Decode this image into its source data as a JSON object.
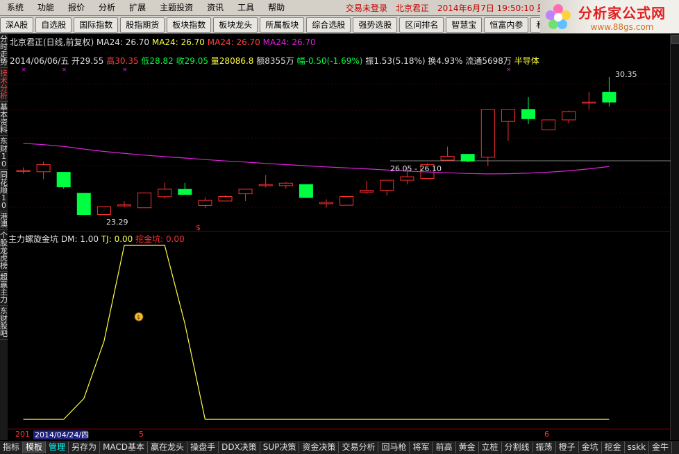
{
  "menu": {
    "items": [
      "系统",
      "功能",
      "报价",
      "分析",
      "扩展",
      "主题投资",
      "资讯",
      "工具",
      "帮助"
    ],
    "status": "交易未登录",
    "stock": "北京君正",
    "datetime": "2014年6月7日 19:50:10 星"
  },
  "toolbar": {
    "buttons": [
      "深A股",
      "自选股",
      "国际指数",
      "股指期货",
      "板块指数",
      "板块龙头",
      "所属板块",
      "综合选股",
      "强势选股",
      "区间排名",
      "智慧宝",
      "恒富内参",
      "私募密"
    ]
  },
  "logo": {
    "title": "分析家公式网",
    "url": "www.88gs.com"
  },
  "left_tabs": [
    "分时走势",
    "技术分析",
    "基本资料",
    "东财10",
    "同花顺10",
    "港澳",
    "个股龙虎榜",
    "超赢主力",
    "东财股吧"
  ],
  "price_panel": {
    "title": "北京君正(日线,前复权)",
    "ma_label": "MA24: 26.70",
    "ma_label2": "MA24: 26.70",
    "ma_label3": "MA24: 26.70",
    "ma_label4": "MA24: 26.70",
    "date": "2014/06/06/五",
    "open": "开29.55",
    "high": "高30.35",
    "low": "低28.82",
    "close": "收29.05",
    "vol": "量28086.8",
    "amount": "额8355万",
    "change": "幅-0.50(-1.69%)",
    "amp": "振1.53(5.18%)",
    "turnover": "换4.93%",
    "float": "流通5698万",
    "sector": "半导体",
    "hi_label": "30.35",
    "lo_label": "23.29",
    "mid_label": "26.05 - 26.10"
  },
  "indicator_panel": {
    "name": "主力螺旋金坑",
    "dm": "DM: 1.00",
    "tj": "TJ: 0.00",
    "wk": "挖金坑: 0.00"
  },
  "xaxis": {
    "left": "201",
    "date": "2014/04/24/四",
    "m5": "5",
    "m6": "6"
  },
  "bottom_tabs": [
    "指标",
    "模板",
    "管理",
    "另存为",
    "MACD基本",
    "赢在龙头",
    "操盘手",
    "DDX决策",
    "SUP决策",
    "资金决策",
    "交易分析",
    "回马枪",
    "将军",
    "前高",
    "黄金",
    "立桩",
    "分割线",
    "振荡",
    "橙子",
    "金坑",
    "挖金",
    "sskk",
    "金牛"
  ],
  "colors": {
    "up": "#ff3030",
    "down": "#00ff40",
    "ma": "#e020e0",
    "indicator": "#ffff40"
  },
  "chart_data": {
    "type": "candlestick",
    "candles": [
      {
        "o": 25.52,
        "h": 25.67,
        "l": 25.35,
        "c": 25.52
      },
      {
        "o": 25.45,
        "h": 25.97,
        "l": 25.06,
        "c": 25.82
      },
      {
        "o": 25.42,
        "h": 25.42,
        "l": 24.57,
        "c": 24.67
      },
      {
        "o": 24.34,
        "h": 24.34,
        "l": 23.24,
        "c": 23.24
      },
      {
        "o": 23.24,
        "h": 23.65,
        "l": 23.24,
        "c": 23.65
      },
      {
        "o": 23.71,
        "h": 23.92,
        "l": 23.62,
        "c": 23.74
      },
      {
        "o": 23.59,
        "h": 24.36,
        "l": 23.59,
        "c": 24.36
      },
      {
        "o": 24.16,
        "h": 24.88,
        "l": 24.06,
        "c": 24.55
      },
      {
        "o": 24.54,
        "h": 24.88,
        "l": 24.28,
        "c": 24.28
      },
      {
        "o": 23.71,
        "h": 24.13,
        "l": 23.57,
        "c": 23.97
      },
      {
        "o": 23.94,
        "h": 24.24,
        "l": 23.94,
        "c": 24.17
      },
      {
        "o": 24.31,
        "h": 24.55,
        "l": 23.94,
        "c": 24.55
      },
      {
        "o": 24.73,
        "h": 25.28,
        "l": 24.64,
        "c": 24.79
      },
      {
        "o": 24.73,
        "h": 24.92,
        "l": 24.58,
        "c": 24.86
      },
      {
        "o": 24.79,
        "h": 24.79,
        "l": 24.12,
        "c": 24.12
      },
      {
        "o": 23.8,
        "h": 24.03,
        "l": 23.6,
        "c": 23.87
      },
      {
        "o": 23.72,
        "h": 24.17,
        "l": 23.72,
        "c": 24.17
      },
      {
        "o": 24.4,
        "h": 24.98,
        "l": 24.34,
        "c": 24.49
      },
      {
        "o": 24.49,
        "h": 25.01,
        "l": 24.22,
        "c": 25.01
      },
      {
        "o": 25.01,
        "h": 25.64,
        "l": 24.8,
        "c": 25.19
      },
      {
        "o": 25.1,
        "h": 25.88,
        "l": 25.1,
        "c": 25.82
      },
      {
        "o": 26.05,
        "h": 26.75,
        "l": 26.05,
        "c": 26.25
      },
      {
        "o": 26.35,
        "h": 26.35,
        "l": 25.95,
        "c": 26.0
      },
      {
        "o": 26.2,
        "h": 28.67,
        "l": 25.75,
        "c": 28.67
      },
      {
        "o": 28.05,
        "h": 28.67,
        "l": 27.05,
        "c": 28.67
      },
      {
        "o": 28.67,
        "h": 29.31,
        "l": 27.91,
        "c": 28.19
      },
      {
        "o": 27.62,
        "h": 28.13,
        "l": 27.62,
        "c": 28.13
      },
      {
        "o": 28.13,
        "h": 28.61,
        "l": 27.94,
        "c": 28.56
      },
      {
        "o": 29.05,
        "h": 29.58,
        "l": 28.67,
        "c": 29.05
      },
      {
        "o": 29.55,
        "h": 30.35,
        "l": 28.82,
        "c": 29.05
      }
    ],
    "ma24": [
      26.92,
      26.85,
      26.76,
      26.62,
      26.5,
      26.4,
      26.31,
      26.23,
      26.16,
      26.08,
      26.01,
      25.95,
      25.88,
      25.82,
      25.76,
      25.7,
      25.65,
      25.6,
      25.54,
      25.48,
      25.44,
      25.4,
      25.36,
      25.34,
      25.35,
      25.38,
      25.43,
      25.5,
      25.6,
      25.72
    ],
    "indicator": [
      0,
      0,
      0,
      0.12,
      0.45,
      1,
      1,
      1,
      0.55,
      0,
      0,
      0,
      0,
      0,
      0,
      0,
      0,
      0,
      0,
      0,
      0,
      0,
      0,
      0,
      0,
      0,
      0,
      0,
      0,
      0
    ],
    "ylim": [
      22.9,
      30.6
    ]
  }
}
